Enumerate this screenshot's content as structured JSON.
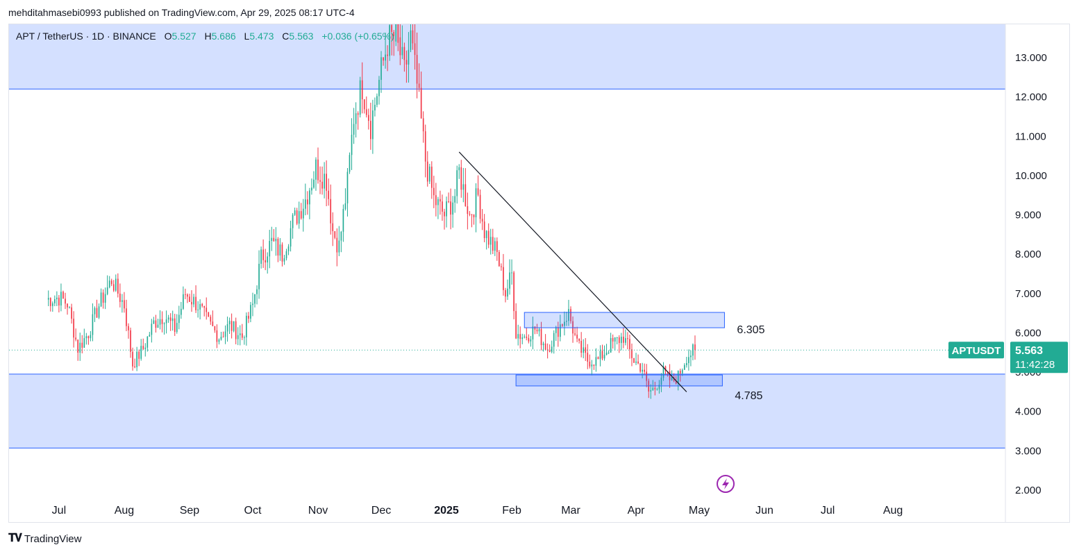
{
  "header": {
    "publisher_line": "mehditahmasebi0993 published on TradingView.com, Apr 29, 2025 08:17 UTC-4"
  },
  "legend": {
    "symbol": "APT / TetherUS · 1D · BINANCE",
    "open_label": "O",
    "open": "5.527",
    "high_label": "H",
    "high": "5.686",
    "low_label": "L",
    "low": "5.473",
    "close_label": "C",
    "close": "5.563",
    "change": "+0.036 (+0.65%)"
  },
  "footer": {
    "brand": "TradingView",
    "logo_icon": "tradingview-logo-icon"
  },
  "chart_data": {
    "type": "candlestick",
    "symbol": "APTUSDT",
    "interval": "1D",
    "exchange": "BINANCE",
    "ylim": [
      1.6,
      13.9
    ],
    "y_ticks": [
      "13.000",
      "12.000",
      "11.000",
      "10.000",
      "9.000",
      "8.000",
      "7.000",
      "6.000",
      "5.000",
      "4.000",
      "3.000",
      "2.000"
    ],
    "x_ticks": [
      "Jul",
      "Aug",
      "Sep",
      "Oct",
      "Nov",
      "Dec",
      "2025",
      "Feb",
      "Mar",
      "Apr",
      "May",
      "Jun",
      "Jul",
      "Aug"
    ],
    "price_path": [
      [
        "2024-06-25",
        6.85
      ],
      [
        "2024-07-01",
        6.9
      ],
      [
        "2024-07-05",
        6.75
      ],
      [
        "2024-07-10",
        5.6
      ],
      [
        "2024-07-15",
        6.0
      ],
      [
        "2024-07-20",
        6.7
      ],
      [
        "2024-07-26",
        7.35
      ],
      [
        "2024-08-01",
        6.7
      ],
      [
        "2024-08-05",
        5.2
      ],
      [
        "2024-08-10",
        5.6
      ],
      [
        "2024-08-15",
        6.25
      ],
      [
        "2024-08-20",
        6.45
      ],
      [
        "2024-08-25",
        6.1
      ],
      [
        "2024-08-30",
        7.0
      ],
      [
        "2024-09-05",
        6.7
      ],
      [
        "2024-09-10",
        6.25
      ],
      [
        "2024-09-15",
        5.9
      ],
      [
        "2024-09-20",
        6.2
      ],
      [
        "2024-09-26",
        5.9
      ],
      [
        "2024-10-01",
        6.7
      ],
      [
        "2024-10-05",
        7.9
      ],
      [
        "2024-10-10",
        8.3
      ],
      [
        "2024-10-15",
        8.0
      ],
      [
        "2024-10-20",
        8.8
      ],
      [
        "2024-10-26",
        9.4
      ],
      [
        "2024-10-31",
        10.2
      ],
      [
        "2024-11-05",
        9.9
      ],
      [
        "2024-11-08",
        8.6
      ],
      [
        "2024-11-11",
        8.2
      ],
      [
        "2024-11-15",
        9.8
      ],
      [
        "2024-11-18",
        11.5
      ],
      [
        "2024-11-22",
        12.3
      ],
      [
        "2024-11-26",
        11.3
      ],
      [
        "2024-11-30",
        12.4
      ],
      [
        "2024-12-04",
        13.4
      ],
      [
        "2024-12-08",
        13.6
      ],
      [
        "2024-12-12",
        12.6
      ],
      [
        "2024-12-15",
        13.5
      ],
      [
        "2024-12-18",
        12.3
      ],
      [
        "2024-12-22",
        10.4
      ],
      [
        "2024-12-26",
        9.4
      ],
      [
        "2024-12-31",
        9.0
      ],
      [
        "2025-01-05",
        9.5
      ],
      [
        "2025-01-07",
        10.1
      ],
      [
        "2025-01-12",
        9.0
      ],
      [
        "2025-01-16",
        9.5
      ],
      [
        "2025-01-19",
        8.6
      ],
      [
        "2025-01-25",
        8.0
      ],
      [
        "2025-01-29",
        7.0
      ],
      [
        "2025-02-01",
        7.5
      ],
      [
        "2025-02-03",
        6.0
      ],
      [
        "2025-02-07",
        5.9
      ],
      [
        "2025-02-12",
        6.1
      ],
      [
        "2025-02-18",
        5.6
      ],
      [
        "2025-02-24",
        6.2
      ],
      [
        "2025-02-28",
        6.5
      ],
      [
        "2025-03-04",
        5.7
      ],
      [
        "2025-03-09",
        5.3
      ],
      [
        "2025-03-14",
        5.3
      ],
      [
        "2025-03-20",
        5.7
      ],
      [
        "2025-03-26",
        5.9
      ],
      [
        "2025-03-31",
        5.3
      ],
      [
        "2025-04-04",
        5.1
      ],
      [
        "2025-04-07",
        4.5
      ],
      [
        "2025-04-10",
        4.6
      ],
      [
        "2025-04-14",
        5.0
      ],
      [
        "2025-04-18",
        4.75
      ],
      [
        "2025-04-21",
        4.9
      ],
      [
        "2025-04-25",
        5.4
      ],
      [
        "2025-04-29",
        5.56
      ]
    ],
    "zones": [
      {
        "name": "upper-supply-zone",
        "low": 12.2,
        "high": 13.9,
        "color": "#d4e0ff"
      },
      {
        "name": "lower-demand-zone",
        "low": 3.07,
        "high": 4.95,
        "color": "#d4e0ff"
      }
    ],
    "boxes": [
      {
        "label": "6.305",
        "x_start": "2025-02-07",
        "x_end": "2025-05-13",
        "low": 6.13,
        "high": 6.52
      },
      {
        "label": "4.785",
        "x_start": "2025-02-03",
        "x_end": "2025-05-12",
        "low": 4.65,
        "high": 4.93
      }
    ],
    "trendline": {
      "from": [
        "2025-01-07",
        10.6
      ],
      "to": [
        "2025-04-25",
        4.5
      ]
    },
    "last_price": {
      "symbol_label": "APTUSDT",
      "price": "5.563",
      "countdown": "11:42:28",
      "value": 5.563
    },
    "colors": {
      "up": "#22ab94",
      "down": "#f23645",
      "zone": "#d4e0ff",
      "zone_line": "#2962ff",
      "last_bg": "#22ab94"
    }
  }
}
